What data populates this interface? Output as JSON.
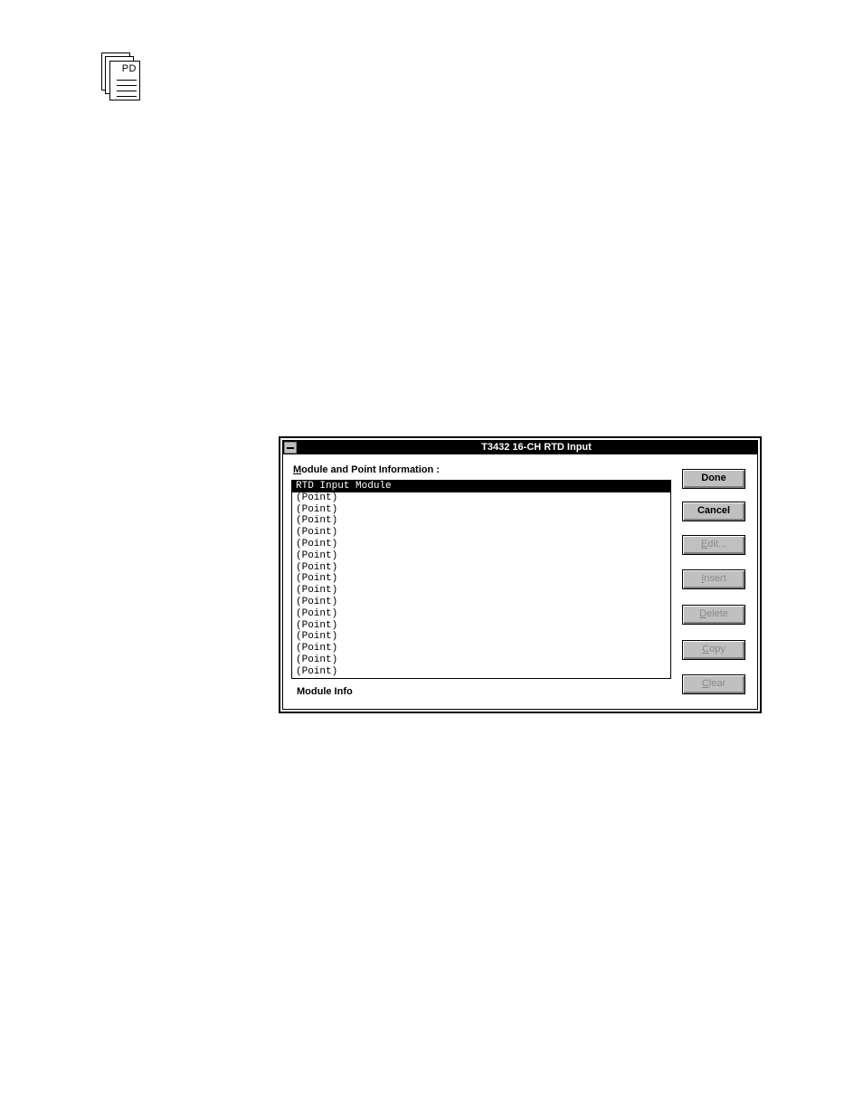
{
  "page_icon": {
    "label": "PD"
  },
  "dialog": {
    "title": "T3432 16-CH  RTD Input",
    "list_label_mnemonic": "M",
    "list_label_rest": "odule and Point Information :",
    "list_items": [
      "RTD Input Module",
      "(Point)",
      "(Point)",
      "(Point)",
      "(Point)",
      "(Point)",
      "(Point)",
      "(Point)",
      "(Point)",
      "(Point)",
      "(Point)",
      "(Point)",
      "(Point)",
      "(Point)",
      "(Point)",
      "(Point)",
      "(Point)"
    ],
    "selected_index": 0,
    "module_info": "Module Info",
    "buttons": {
      "done": "Done",
      "cancel": "Cancel",
      "edit": {
        "mn": "E",
        "rest": "dit..."
      },
      "insert": {
        "mn": "I",
        "rest": "nsert"
      },
      "delete": {
        "mn": "D",
        "rest": "elete"
      },
      "copy": {
        "mn": "C",
        "rest": "opy"
      },
      "clear": {
        "mn": "C",
        "rest": "lear"
      }
    }
  },
  "colors": {
    "titlebar": "#000000",
    "button_face": "#c0c0c0",
    "disabled_text": "#8a8a8a"
  }
}
